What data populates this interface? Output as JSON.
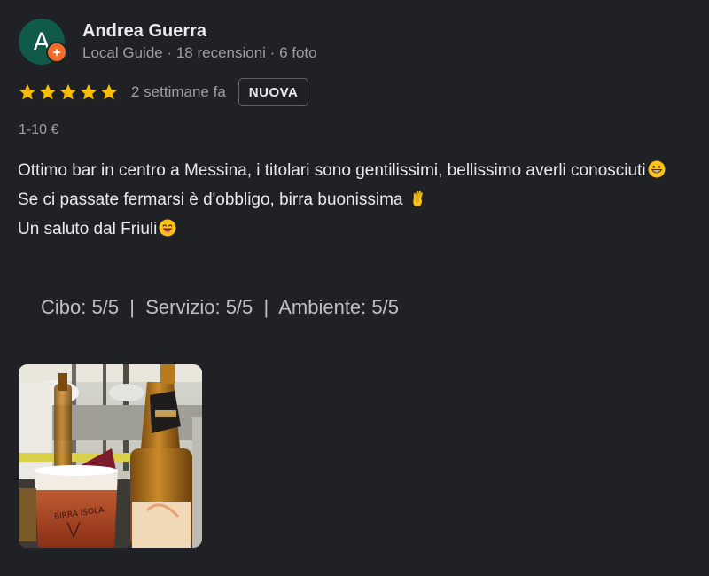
{
  "author": {
    "initial": "A",
    "name": "Andrea Guerra",
    "meta": "Local Guide · 18 recensioni · 6 foto"
  },
  "review": {
    "rating": 5,
    "rating_max": 5,
    "time": "2 settimane fa",
    "badge": "NUOVA",
    "price": "1-10 €",
    "text_line1": "Ottimo bar in centro a Messina, i titolari sono gentilissimi, bellissimo averli conosciuti",
    "text_line2": "Se ci passate fermarsi è d'obbligo, birra buonissima",
    "text_line3": "Un saluto dal Friuli",
    "subratings": "Cibo: 5/5  |  Servizio: 5/5  |  Ambiente: 5/5"
  },
  "icons": {
    "avatar_badge": "local-guide-star-icon",
    "rating": "star-icon",
    "emoji_1": "grinning-face-emoji",
    "emoji_2": "ok-hand-emoji",
    "emoji_3": "smiling-face-emoji"
  },
  "colors": {
    "background": "#202124",
    "avatar": "#0f5a4a",
    "guide_badge": "#f06c2b",
    "star": "#fbbc04",
    "text_secondary": "#9aa0a6"
  }
}
